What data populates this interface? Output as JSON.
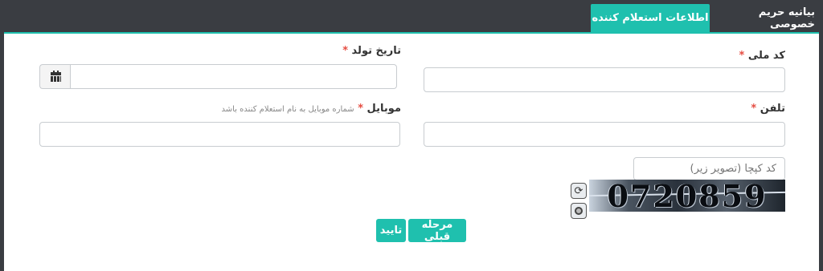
{
  "tabs": {
    "privacy": "بیانیه حریم خصوصی",
    "applicant_info": "اطلاعات استعلام کننده"
  },
  "form": {
    "national_code": {
      "label": "کد ملی",
      "required": "*",
      "value": ""
    },
    "birth_date": {
      "label": "تاریخ تولد",
      "required": "*",
      "value": ""
    },
    "phone": {
      "label": "تلفن",
      "required": "*",
      "value": ""
    },
    "mobile": {
      "label": "موبایل",
      "required": "*",
      "hint": "شماره موبایل به نام استعلام کننده باشد",
      "value": ""
    },
    "captcha": {
      "placeholder": "کد کپچا (تصویر زیر)",
      "image_text": "0720859"
    }
  },
  "buttons": {
    "previous": "مرحله قبلی",
    "confirm": "تایید"
  },
  "colors": {
    "accent": "#1fc0ae",
    "required": "#e54d42",
    "frame": "#3a3d42"
  }
}
